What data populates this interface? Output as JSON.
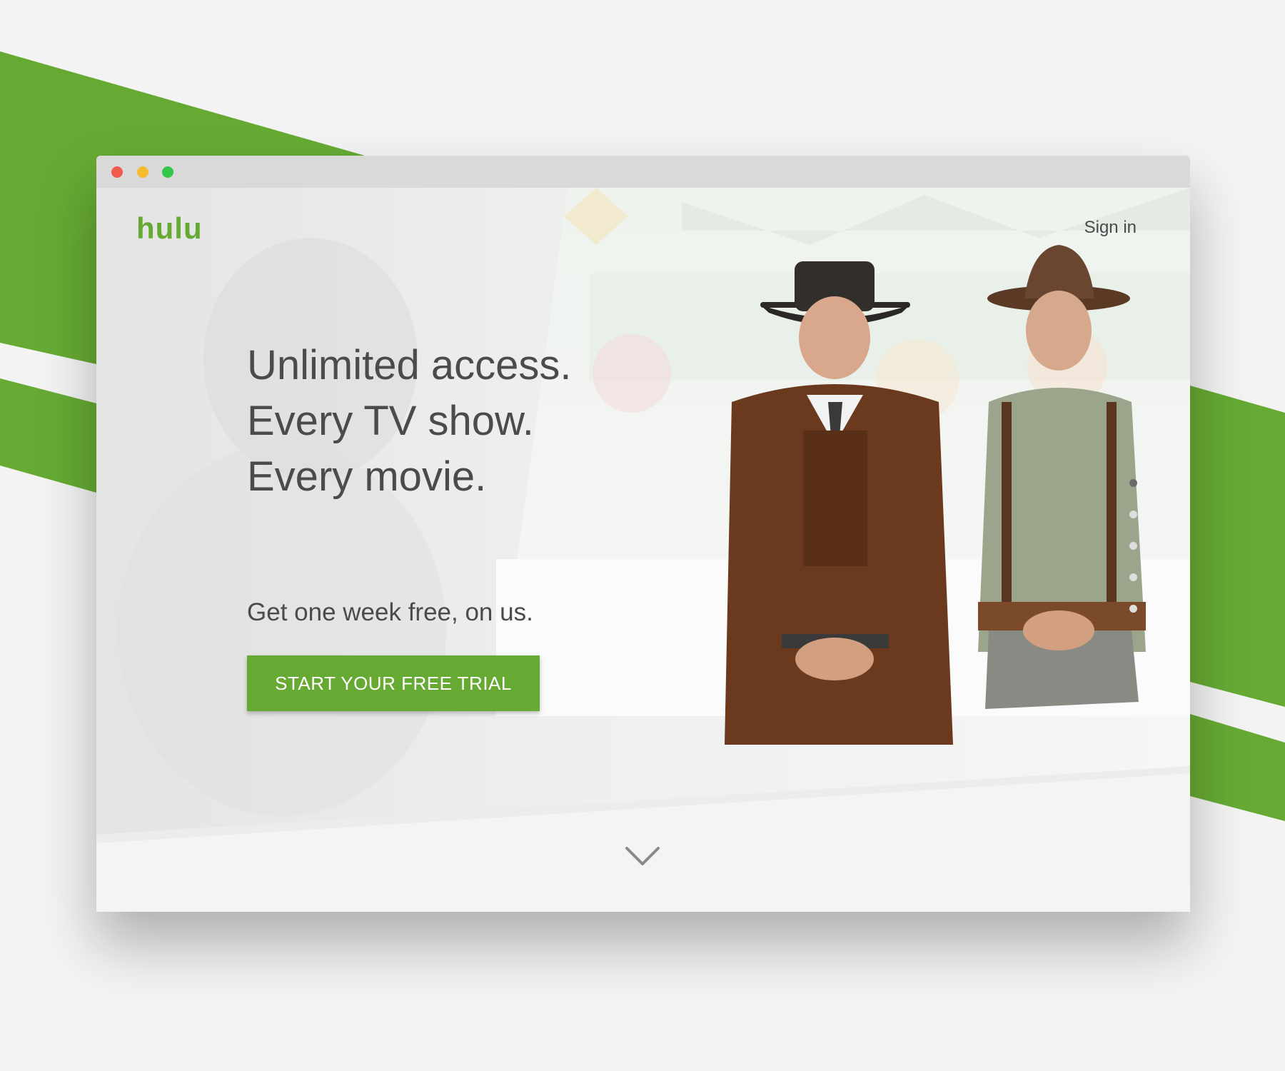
{
  "colors": {
    "brand_green": "#66aa33",
    "page_background": "#f3f3f3",
    "text_dark": "#4b4b4b"
  },
  "window": {
    "controls": [
      "close",
      "minimize",
      "maximize"
    ]
  },
  "header": {
    "logo": "hulu",
    "sign_in": "Sign in"
  },
  "hero": {
    "headline_lines": [
      "Unlimited access.",
      "Every TV show.",
      "Every movie."
    ],
    "subhead": "Get one week free, on us.",
    "cta_label": "START YOUR FREE TRIAL",
    "carousel": {
      "slide_count": 5,
      "active_index": 0
    },
    "scroll_icon": "chevron-down-icon"
  }
}
